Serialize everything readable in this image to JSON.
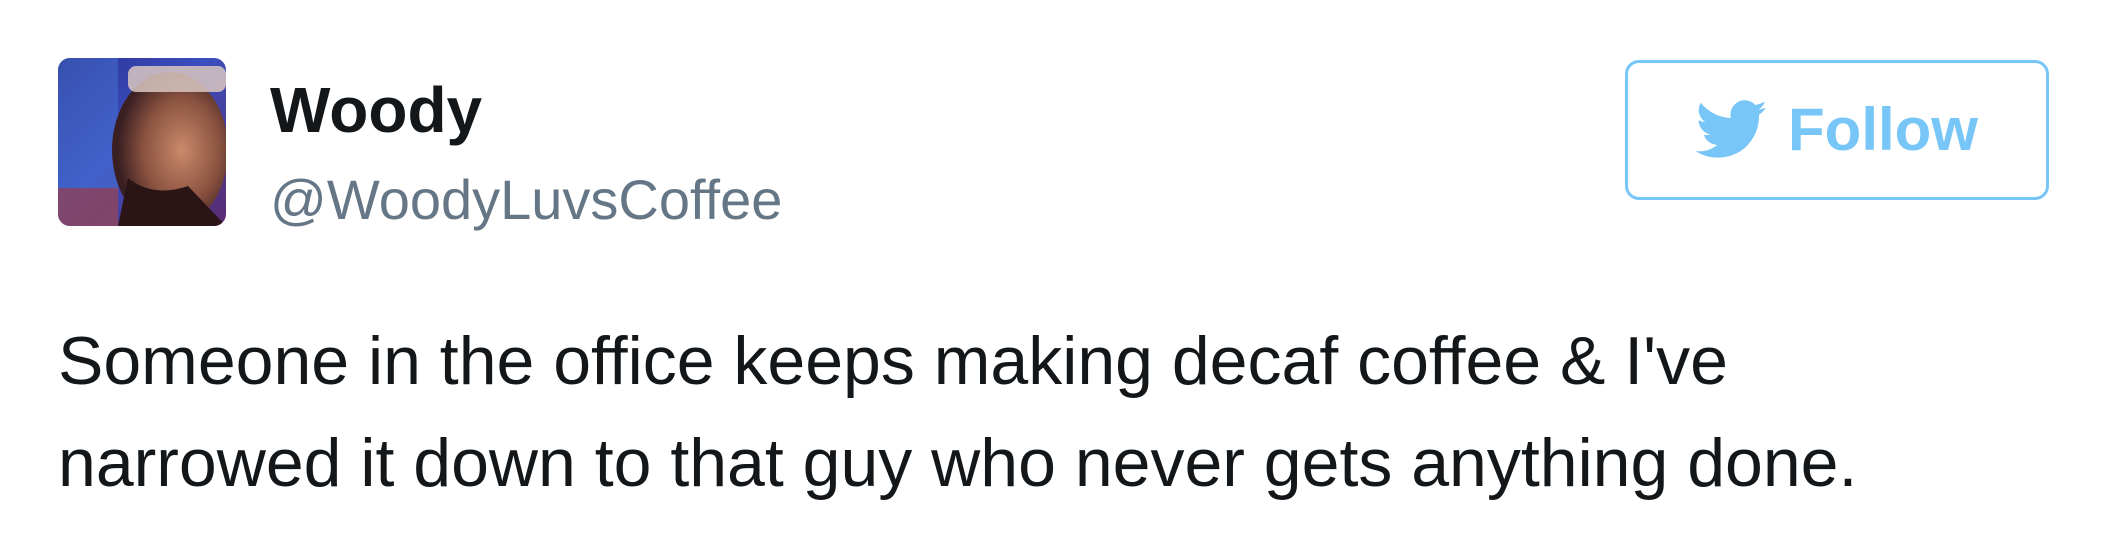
{
  "user": {
    "display_name": "Woody",
    "handle": "@WoodyLuvsCoffee"
  },
  "follow_button": {
    "label": "Follow",
    "icon": "twitter-bird-icon"
  },
  "tweet": {
    "lines": [
      "Someone in the office keeps making decaf coffee & I've",
      "narrowed it down to that guy who never gets anything done."
    ]
  },
  "colors": {
    "accent": "#1da1f2",
    "text": "#14171a",
    "secondary_text": "#657786"
  }
}
